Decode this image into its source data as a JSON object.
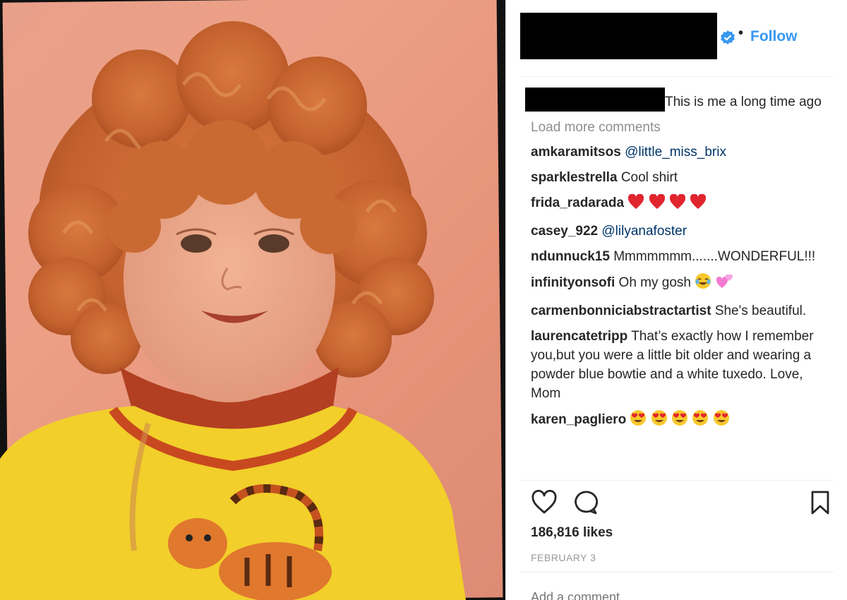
{
  "header": {
    "follow_label": "Follow",
    "separator": "•"
  },
  "caption": {
    "text": "This is me a long time ago"
  },
  "load_more_label": "Load more comments",
  "comments": [
    {
      "user": "amkaramitsos",
      "text": "",
      "mention": "@little_miss_brix"
    },
    {
      "user": "sparklestrella",
      "text": "Cool shirt",
      "mention": ""
    },
    {
      "user": "frida_radarada",
      "text": "",
      "mention": "",
      "emoji": "red-heart-icon x4"
    },
    {
      "user": "casey_922",
      "text": "",
      "mention": "@lilyanafoster"
    },
    {
      "user": "ndunnuck15",
      "text": "Mmmmmmm.......WONDERFUL!!!",
      "mention": ""
    },
    {
      "user": "infinityonsofi",
      "text": "Oh my gosh",
      "mention": "",
      "emoji": "tears-of-joy-icon, two-hearts-icon"
    },
    {
      "user": "carmenbonniciabstractartist",
      "text": "She's beautiful.",
      "mention": ""
    },
    {
      "user": "laurencatetripp",
      "text": "That’s exactly how I remember you,but you were a little bit older and wearing a powder blue bowtie and a white tuxedo. Love, Mom",
      "mention": ""
    },
    {
      "user": "karen_pagliero",
      "text": "",
      "mention": "",
      "emoji": "heart-eyes-icon x5"
    }
  ],
  "likes": "186,816 likes",
  "date": "FEBRUARY 3",
  "add_comment_placeholder": "Add a comment…",
  "colors": {
    "follow": "#3897f0",
    "mention": "#003569",
    "muted": "#8e8e8e"
  }
}
